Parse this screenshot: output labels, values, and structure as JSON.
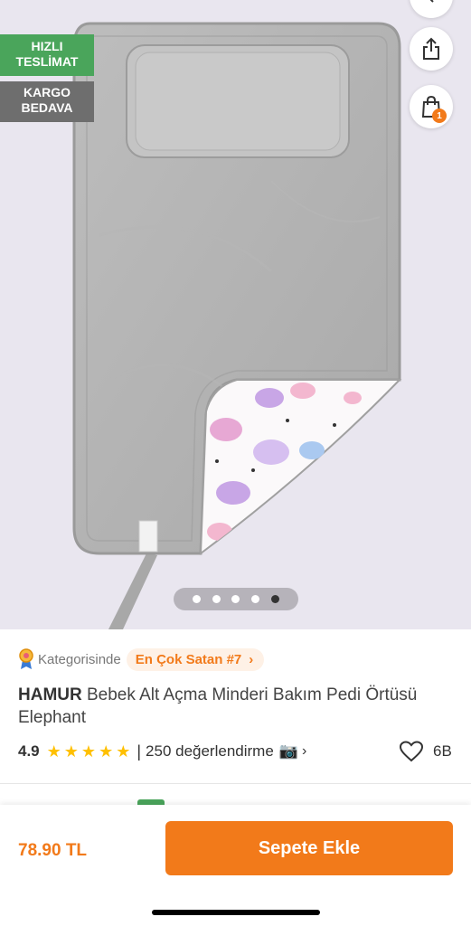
{
  "badges": {
    "fast_delivery": [
      "HIZLI",
      "TESLİMAT"
    ],
    "free_shipping": [
      "KARGO",
      "BEDAVA"
    ]
  },
  "cart": {
    "count": "1"
  },
  "gallery": {
    "total_images": 5,
    "active_index": 4
  },
  "category": {
    "label": "Kategorisinde",
    "bestseller": "En Çok Satan #7"
  },
  "product": {
    "brand": "HAMUR",
    "name": "Bebek Alt Açma Minderi Bakım Pedi Örtüsü Elephant",
    "rating": "4.9",
    "stars": 5,
    "review_separator": "|",
    "review_count": "250 değerlendirme",
    "favorites": "6B"
  },
  "purchase": {
    "price": "78.90 TL",
    "add_to_cart": "Sepete Ekle"
  },
  "colors": {
    "accent": "#f27a1a",
    "fast_badge": "#4aa55b",
    "cargo_badge": "#6e6e6e",
    "star": "#ffc000",
    "image_background": "#e9e6ef"
  },
  "icons": [
    "back-icon",
    "share-icon",
    "shopping-bag-icon",
    "award-ribbon-icon",
    "chevron-right-icon",
    "star-icon",
    "camera-icon",
    "heart-icon"
  ]
}
